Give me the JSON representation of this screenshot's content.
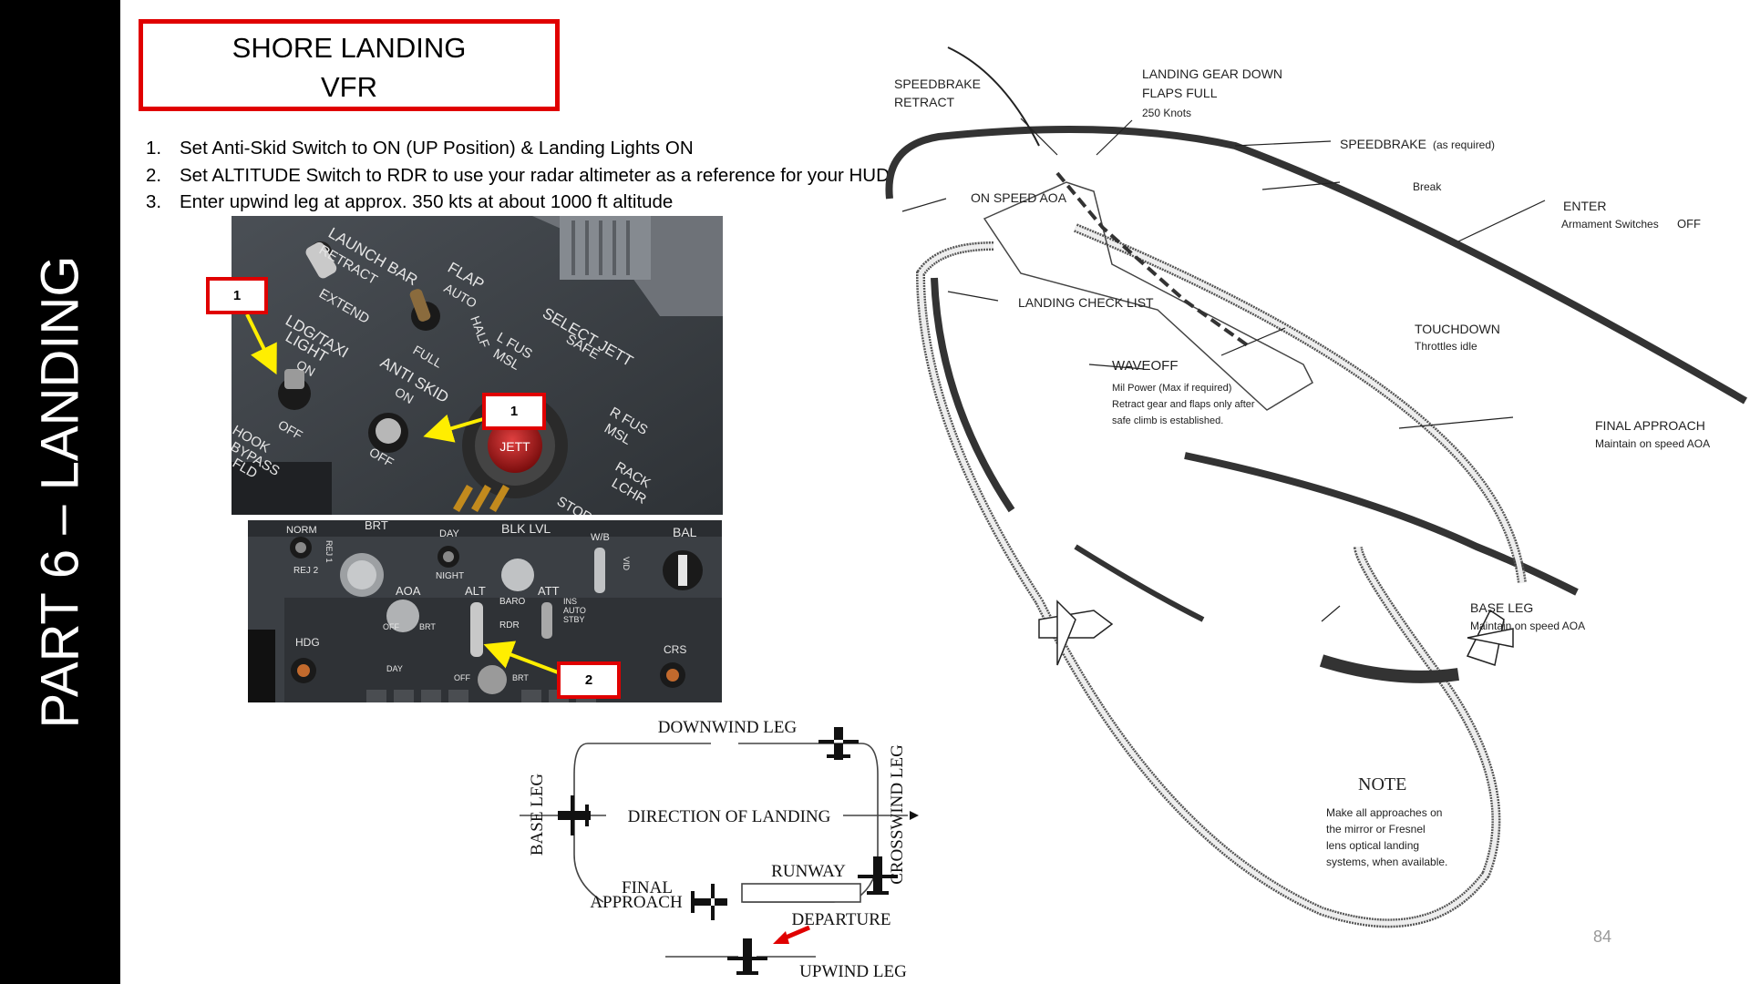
{
  "sidebar": {
    "title": "PART 6 – LANDING"
  },
  "title_box": {
    "line1": "SHORE LANDING",
    "line2": "VFR"
  },
  "steps": [
    {
      "num": "1.",
      "text": "Set Anti-Skid Switch to ON (UP Position) & Landing Lights ON"
    },
    {
      "num": "2.",
      "text": "Set ALTITUDE Switch to RDR to use your radar altimeter as a reference for your HUD."
    },
    {
      "num": "3.",
      "text": "Enter upwind leg at approx. 350 kts at about 1000 ft altitude"
    }
  ],
  "callouts": {
    "c1a": "1",
    "c1b": "1",
    "c2": "2"
  },
  "panel_top_labels": {
    "launch_bar": "LAUNCH BAR",
    "retract": "RETRACT",
    "extend": "EXTEND",
    "flap": "FLAP",
    "auto": "AUTO",
    "half": "HALF",
    "full": "FULL",
    "ldg_taxi": "LDG/TAXI",
    "light": "LIGHT",
    "on1": "ON",
    "off1": "OFF",
    "anti_skid": "ANTI SKID",
    "on2": "ON",
    "off2": "OFF",
    "select_jett": "SELECT JETT",
    "safe": "SAFE",
    "lfus": "L FUS",
    "msl": "MSL",
    "rfus": "R FUS",
    "msl2": "MSL",
    "rack": "RACK",
    "lchr": "LCHR",
    "stores": "STORES",
    "jett": "JETT",
    "hook": "HOOK",
    "bypass": "BYPASS",
    "fld": "FLD"
  },
  "panel_bottom_labels": {
    "norm": "NORM",
    "rej1": "REJ 1",
    "rej2": "REJ 2",
    "brt": "BRT",
    "day": "DAY",
    "night": "NIGHT",
    "blk_lvl": "BLK LVL",
    "bal": "BAL",
    "wb": "W/B",
    "vid": "VID",
    "aoa": "AOA",
    "alt": "ALT",
    "baro": "BARO",
    "rdr": "RDR",
    "att": "ATT",
    "ins": "INS",
    "auto": "AUTO",
    "stby": "STBY",
    "hdg": "HDG",
    "crs": "CRS",
    "day2": "DAY",
    "off": "OFF",
    "brt2": "BRT",
    "brt3": "BRT",
    "off_knob": "OFF"
  },
  "pattern_small": {
    "downwind": "DOWNWIND LEG",
    "base": "BASE LEG",
    "crosswind": "CROSSWIND LEG",
    "direction": "DIRECTION OF LANDING",
    "final1": "FINAL",
    "final2": "APPROACH",
    "runway": "RUNWAY",
    "departure": "DEPARTURE",
    "upwind": "UPWIND LEG"
  },
  "pattern_large": {
    "speedbrake_retract_1": "SPEEDBRAKE",
    "speedbrake_retract_2": "RETRACT",
    "gear_down_1": "LANDING GEAR DOWN",
    "gear_down_2": "FLAPS FULL",
    "gear_down_3": "250 Knots",
    "speedbrake": "SPEEDBRAKE",
    "as_required": "(as required)",
    "break": "Break",
    "enter": "ENTER",
    "armament": "Armament Switches",
    "off": "OFF",
    "on_speed": "ON SPEED AOA",
    "check_list": "LANDING CHECK LIST",
    "touchdown": "TOUCHDOWN",
    "throttles": "Throttles idle",
    "waveoff": "WAVEOFF",
    "waveoff_1": "Mil Power (Max if required)",
    "waveoff_2": "Retract gear and flaps only after",
    "waveoff_3": "safe climb is established.",
    "final": "FINAL APPROACH",
    "final_sub": "Maintain on speed AOA",
    "base": "BASE LEG",
    "base_sub": "Maintain on speed AOA",
    "note": "NOTE",
    "note_1": "Make all approaches on",
    "note_2": "the mirror or Fresnel",
    "note_3": "lens optical landing",
    "note_4": "systems, when available."
  },
  "page_number": "84",
  "colors": {
    "accent_red": "#e00000",
    "arrow_yellow": "#ffee00",
    "sidebar_bg": "#000000"
  }
}
